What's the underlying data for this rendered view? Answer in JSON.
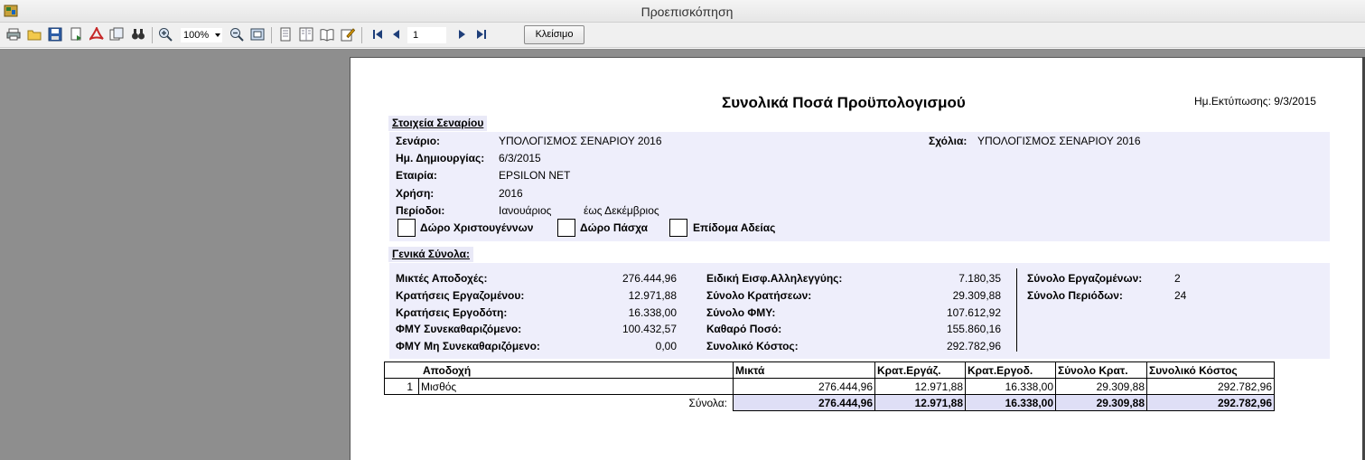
{
  "window": {
    "title": "Προεπισκόπηση"
  },
  "toolbar": {
    "zoom": "100%",
    "page": "1",
    "close_label": "Κλείσιμο"
  },
  "report": {
    "title": "Συνολικά Ποσά Προϋπολογισμού",
    "print_date": "Ημ.Εκτύπωσης: 9/3/2015",
    "scenario_section": "Στοιχεία Σεναρίου",
    "scenario_label": "Σενάριο:",
    "scenario_value": "ΥΠΟΛΟΓΙΣΜΟΣ ΣΕΝΑΡΙΟΥ 2016",
    "comments_label": "Σχόλια:",
    "comments_value": "ΥΠΟΛΟΓΙΣΜΟΣ ΣΕΝΑΡΙΟΥ 2016",
    "created_label": "Ημ. Δημιουργίας:",
    "created_value": "6/3/2015",
    "company_label": "Εταιρία:",
    "company_value": "EPSILON NET",
    "year_label": "Χρήση:",
    "year_value": "2016",
    "periods_label": "Περίοδοι:",
    "period_from": "Ιανουάριος",
    "period_to": "έως Δεκέμβριος",
    "checkboxes": [
      {
        "label": "Δώρο Χριστουγέννων",
        "checked": false
      },
      {
        "label": "Δώρο Πάσχα",
        "checked": false
      },
      {
        "label": "Επίδομα Αδείας",
        "checked": false
      }
    ],
    "totals_section": "Γενικά Σύνολα:",
    "totals": {
      "col1": [
        {
          "label": "Μικτές Αποδοχές:",
          "value": "276.444,96"
        },
        {
          "label": "Κρατήσεις Εργαζομένου:",
          "value": "12.971,88"
        },
        {
          "label": "Κρατήσεις Εργοδότη:",
          "value": "16.338,00"
        },
        {
          "label": "ΦΜΥ Συνεκαθαριζόμενο:",
          "value": "100.432,57"
        },
        {
          "label": "ΦΜΥ Μη Συνεκαθαριζόμενο:",
          "value": "0,00"
        }
      ],
      "col2": [
        {
          "label": "Ειδική Εισφ.Αλληλεγγύης:",
          "value": "7.180,35"
        },
        {
          "label": "Σύνολο Κρατήσεων:",
          "value": "29.309,88"
        },
        {
          "label": "Σύνολο ΦΜΥ:",
          "value": "107.612,92"
        },
        {
          "label": "Καθαρό Ποσό:",
          "value": "155.860,16"
        },
        {
          "label": "Συνολικό Κόστος:",
          "value": "292.782,96"
        }
      ],
      "col3": [
        {
          "label": "Σύνολο Εργαζομένων:",
          "value": "2"
        },
        {
          "label": "Σύνολο Περιόδων:",
          "value": "24"
        }
      ]
    },
    "table": {
      "headers": [
        "Αποδοχή",
        "Μικτά",
        "Κρατ.Εργάζ.",
        "Κρατ.Εργοδ.",
        "Σύνολο Κρατ.",
        "Συνολικό Κόστος"
      ],
      "rows": [
        {
          "no": "1",
          "name": "Μισθός",
          "gross": "276.444,96",
          "emp": "12.971,88",
          "employer": "16.338,00",
          "total_ded": "29.309,88",
          "total_cost": "292.782,96"
        }
      ],
      "totals_label": "Σύνολα:",
      "totals": {
        "gross": "276.444,96",
        "emp": "12.971,88",
        "employer": "16.338,00",
        "total_ded": "29.309,88",
        "total_cost": "292.782,96"
      }
    }
  }
}
